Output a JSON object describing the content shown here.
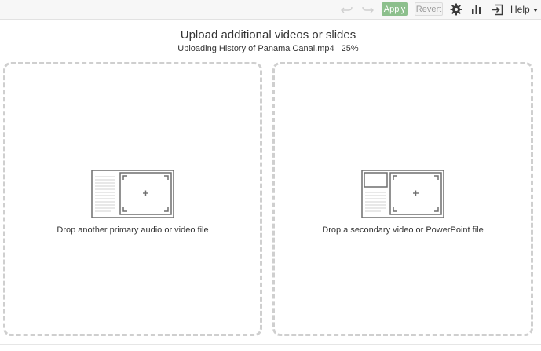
{
  "toolbar": {
    "undo_icon": "undo-icon",
    "redo_icon": "redo-icon",
    "apply_label": "Apply",
    "revert_label": "Revert",
    "settings_icon": "gear-icon",
    "stats_icon": "bar-chart-icon",
    "exit_icon": "exit-icon",
    "help_label": "Help"
  },
  "header": {
    "title": "Upload additional videos or slides",
    "uploading_text": "Uploading History of Panama Canal.mp4",
    "progress": "25%"
  },
  "dropzones": {
    "primary": {
      "label": "Drop another primary audio or video file"
    },
    "secondary": {
      "label": "Drop a secondary video or PowerPoint file"
    }
  },
  "colors": {
    "apply_bg": "#8cbf8c",
    "dash_border": "#cfcfcf",
    "toolbar_bg": "#f7f7f7"
  }
}
